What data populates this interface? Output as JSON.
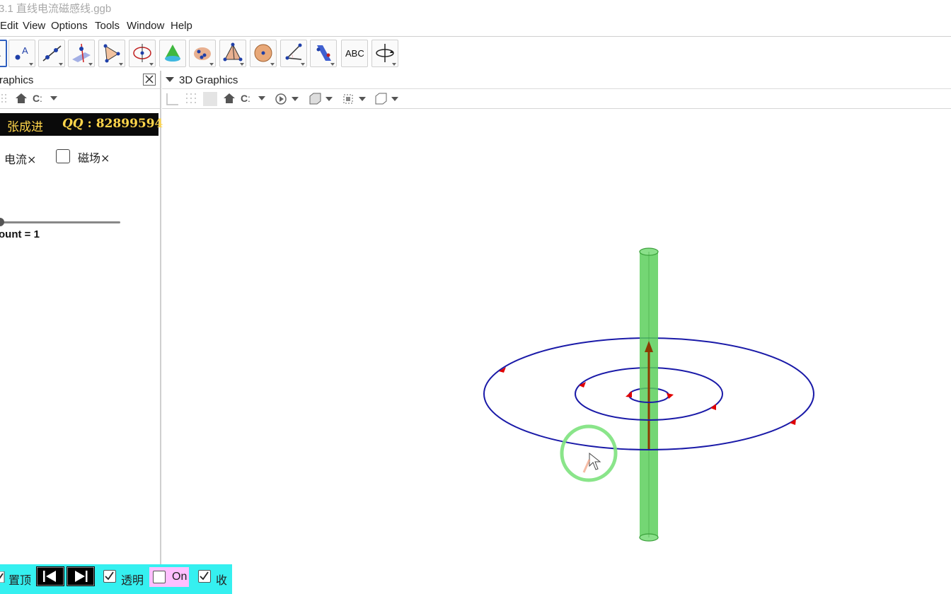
{
  "window": {
    "title": "3.1 直线电流磁感线.ggb"
  },
  "menu": [
    "Edit",
    "View",
    "Options",
    "Tools",
    "Window",
    "Help"
  ],
  "toolbar": {
    "tools": [
      "move-tool-icon",
      "point-tool-icon",
      "line-tool-icon",
      "perpendicular-tool-icon",
      "polygon-tool-icon",
      "circle-tool-icon",
      "cone-tool-icon",
      "intersect-tool-icon",
      "pyramid-tool-icon",
      "sphere-tool-icon",
      "angle-tool-icon",
      "reflect-tool-icon",
      "text-tool-icon",
      "rotate-view-tool-icon"
    ],
    "text_tool_label": "ABC"
  },
  "graphics_panel": {
    "title": "raphics",
    "banner": {
      "author": "张成进",
      "qq_prefix": "QQ",
      "qq_sep": " : ",
      "qq_number": "82899594"
    },
    "checkbox_current": {
      "label": "电流×",
      "checked": false
    },
    "checkbox_field": {
      "label": "磁场×",
      "checked": false
    },
    "slider_label": "ount = 1",
    "slider_value": 1
  },
  "panel_3d": {
    "title": "3D Graphics"
  },
  "bottom_bar": {
    "pin_label": "置顶",
    "transparent_label": "透明",
    "on_label": "On",
    "collapse_label": "收",
    "transparent_checked": true,
    "on_checked": false,
    "collapse_checked": true,
    "colors": {
      "background": "#35f0f0",
      "on_bg": "#ffbfff"
    }
  },
  "scene_colors": {
    "wire": "#5ccf5c",
    "field_line": "#1a1aa8",
    "arrow": "#8b3a00",
    "marker": "#e00000"
  }
}
